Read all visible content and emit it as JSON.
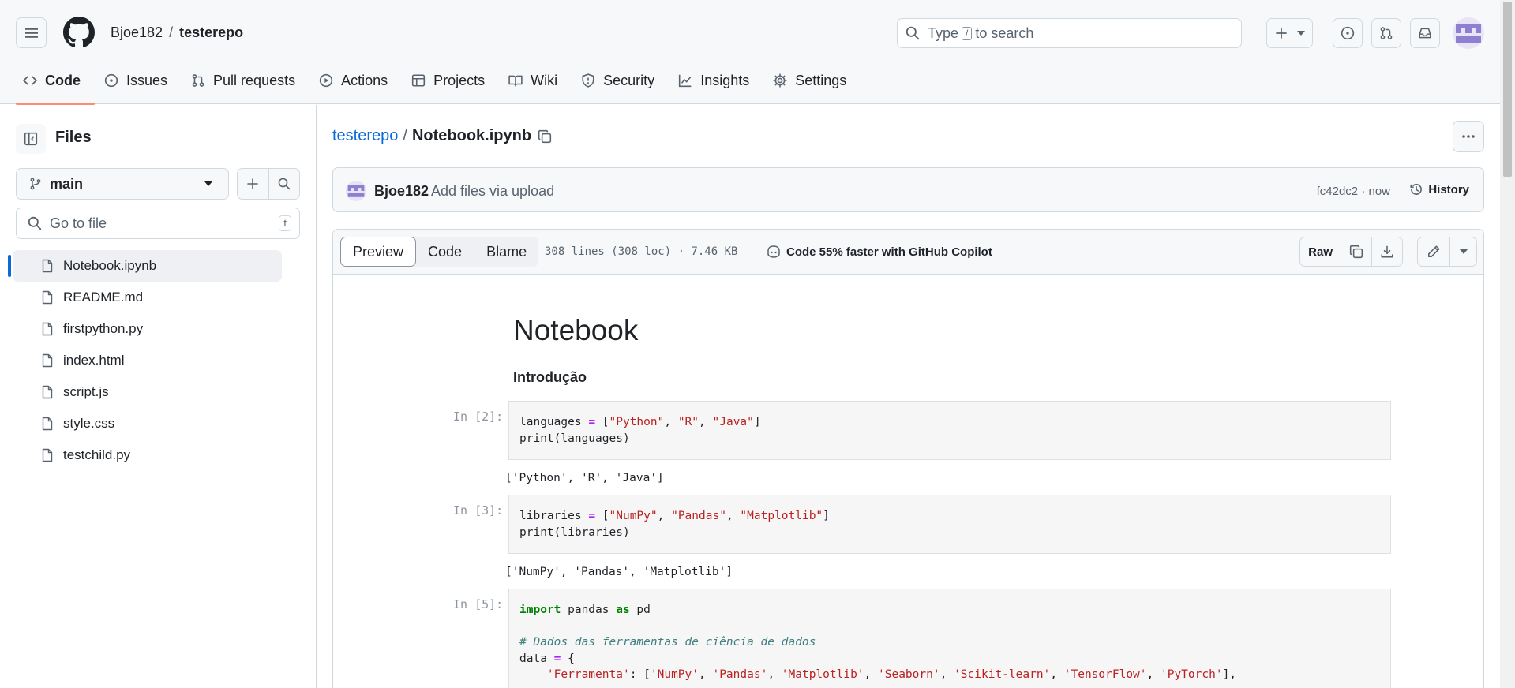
{
  "header": {
    "owner": "Bjoe182",
    "separator": "/",
    "repo": "testerepo",
    "search_placeholder_pre": "Type",
    "search_key": "/",
    "search_placeholder_post": "to search"
  },
  "tabs": [
    {
      "label": "Code",
      "icon": "code-icon",
      "active": true
    },
    {
      "label": "Issues",
      "icon": "issue-opened-icon"
    },
    {
      "label": "Pull requests",
      "icon": "git-pull-request-icon"
    },
    {
      "label": "Actions",
      "icon": "play-icon"
    },
    {
      "label": "Projects",
      "icon": "table-icon"
    },
    {
      "label": "Wiki",
      "icon": "book-icon"
    },
    {
      "label": "Security",
      "icon": "shield-icon"
    },
    {
      "label": "Insights",
      "icon": "graph-icon"
    },
    {
      "label": "Settings",
      "icon": "gear-icon"
    }
  ],
  "sidebar": {
    "title": "Files",
    "branch": "main",
    "goto_placeholder": "Go to file",
    "goto_key": "t",
    "files": [
      "Notebook.ipynb",
      "README.md",
      "firstpython.py",
      "index.html",
      "script.js",
      "style.css",
      "testchild.py"
    ],
    "active_file": "Notebook.ipynb"
  },
  "main": {
    "path_repo": "testerepo",
    "path_sep": "/",
    "path_file": "Notebook.ipynb",
    "commit": {
      "user": "Bjoe182",
      "message": "Add files via upload",
      "hash_time": "fc42dc2 · now",
      "history": "History"
    },
    "viewer": {
      "modes": [
        "Preview",
        "Code",
        "Blame"
      ],
      "active_mode": "Preview",
      "info": "308 lines (308 loc) · 7.46 KB",
      "copilot": "Code 55% faster with GitHub Copilot",
      "raw": "Raw"
    },
    "notebook": {
      "title": "Notebook",
      "subtitle": "Introdução",
      "cells": [
        {
          "prompt": "In [2]:",
          "output": "['Python', 'R', 'Java']"
        },
        {
          "prompt": "In [3]:",
          "output": "['NumPy', 'Pandas', 'Matplotlib']"
        },
        {
          "prompt": "In [5]:",
          "output": ""
        }
      ]
    }
  },
  "colors": {
    "accent": "#0969da",
    "tab_underline": "#fd8c73",
    "header_bg": "#f6f8fa",
    "border": "#d1d9e0"
  }
}
